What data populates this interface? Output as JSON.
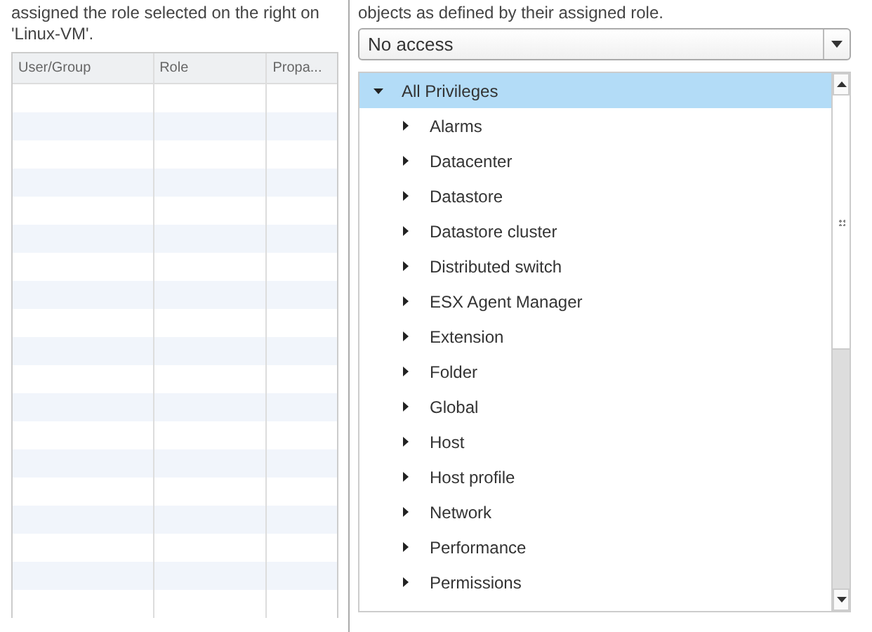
{
  "left_panel": {
    "description": [
      "assigned the role selected on the right on",
      "'Linux-VM'."
    ],
    "table": {
      "columns": [
        "User/Group",
        "Role",
        "Propa..."
      ]
    }
  },
  "right_panel": {
    "description": "objects as defined by their assigned role.",
    "role_dropdown": {
      "value": "No access"
    },
    "privileges_tree": [
      {
        "label": "All Privileges",
        "expanded": true,
        "selected": true,
        "children": [
          {
            "label": "Alarms",
            "expanded": false,
            "selected": false
          },
          {
            "label": "Datacenter",
            "expanded": false,
            "selected": false
          },
          {
            "label": "Datastore",
            "expanded": false,
            "selected": false
          },
          {
            "label": "Datastore cluster",
            "expanded": false,
            "selected": false
          },
          {
            "label": "Distributed switch",
            "expanded": false,
            "selected": false
          },
          {
            "label": "ESX Agent Manager",
            "expanded": false,
            "selected": false
          },
          {
            "label": "Extension",
            "expanded": false,
            "selected": false
          },
          {
            "label": "Folder",
            "expanded": false,
            "selected": false
          },
          {
            "label": "Global",
            "expanded": false,
            "selected": false
          },
          {
            "label": "Host",
            "expanded": false,
            "selected": false
          },
          {
            "label": "Host profile",
            "expanded": false,
            "selected": false
          },
          {
            "label": "Network",
            "expanded": false,
            "selected": false
          },
          {
            "label": "Performance",
            "expanded": false,
            "selected": false
          },
          {
            "label": "Permissions",
            "expanded": false,
            "selected": false
          }
        ]
      }
    ]
  }
}
